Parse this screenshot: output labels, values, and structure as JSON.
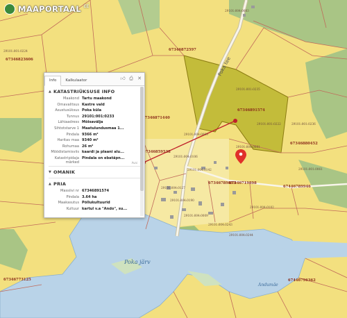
{
  "logo": {
    "text": "MAAPORTAAL",
    "sup": "EE"
  },
  "panel": {
    "tabs": [
      "Info",
      "Kalkulaator"
    ],
    "section_info": "KATASTRIÜKSUSE INFO",
    "rows": [
      {
        "k": "Maakond",
        "v": "Tartu maakond"
      },
      {
        "k": "Omavalitsus",
        "v": "Kastre vald"
      },
      {
        "k": "Asustusüksus",
        "v": "Poka küla"
      },
      {
        "k": "Tunnus",
        "v": "29101:001:0233"
      },
      {
        "k": "Lähiaadress",
        "v": "Mõisavälja"
      },
      {
        "k": "Sihtotstarve 1",
        "v": "Maatulundusmaa 1..."
      },
      {
        "k": "Pindala",
        "v": "9366 m²"
      },
      {
        "k": "Haritav maa",
        "v": "9340 m²"
      },
      {
        "k": "Rohumaa",
        "v": "26 m²"
      },
      {
        "k": "Mõõdistamisviis",
        "v": "kaardi ja plaani alu..."
      },
      {
        "k": "Katastripidaja märked",
        "v": "Pindala on ebatäpn..."
      }
    ],
    "more_link": "Avai",
    "section_omanik": "OMANIK",
    "section_pria": "PRIA",
    "pria_rows": [
      {
        "k": "Massiivi nr",
        "v": "67346891574"
      },
      {
        "k": "Pindala",
        "v": "3.64 ha"
      },
      {
        "k": "Maakasutus",
        "v": "Põllukultuurid"
      },
      {
        "k": "Kultuur",
        "v": "kartul v.a \"Ando\", su..."
      }
    ]
  },
  "map": {
    "lake_name": "Poka järv",
    "river_name": "Andumäe",
    "road_name": "Poka tee",
    "labels": [
      {
        "t": "67346823606"
      },
      {
        "t": "67346872597"
      },
      {
        "t": "67346871440"
      },
      {
        "t": "67346891574"
      },
      {
        "t": "67346880452"
      },
      {
        "t": "67446789946"
      },
      {
        "t": "67446796362"
      },
      {
        "t": "67346773125"
      },
      {
        "t": "67346859538"
      },
      {
        "t": "67346789853"
      },
      {
        "t": "67346719898"
      },
      {
        "t": "29101:004:0083"
      },
      {
        "t": "29101:001:0235"
      },
      {
        "t": "29101:001:0222"
      },
      {
        "t": "29101:004:0099"
      },
      {
        "t": "29101:004:0106"
      },
      {
        "t": "29101:004:0142"
      },
      {
        "t": "29101:004:0127"
      },
      {
        "t": "29101:004:0190"
      },
      {
        "t": "29101:001:0236"
      },
      {
        "t": "29101:004:0081"
      },
      {
        "t": "29101:004:0009"
      },
      {
        "t": "29101:004:0243"
      },
      {
        "t": "29101:004:0244"
      },
      {
        "t": "29101:001:0061"
      },
      {
        "t": "29101:004:0102"
      },
      {
        "t": "29101:001:0224"
      }
    ]
  },
  "colors": {
    "parcel_fill": "#f3e07f",
    "highlight": "#c3bc3a",
    "water": "#b9d3e8",
    "forest": "#9fbf7a",
    "border": "#c06a5a",
    "measure_line": "#c0202a",
    "marker": "#e0302a"
  }
}
